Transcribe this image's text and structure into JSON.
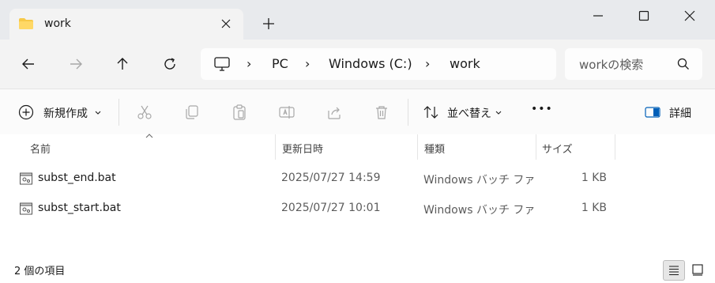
{
  "tab": {
    "title": "work",
    "folder_icon": "folder-icon",
    "close_icon": "close-icon"
  },
  "window_controls": {
    "minimize": "minimize-icon",
    "maximize": "maximize-icon",
    "close": "close-icon"
  },
  "nav": {
    "back": "back-arrow-icon",
    "forward": "forward-arrow-icon",
    "up": "up-arrow-icon",
    "refresh": "refresh-icon"
  },
  "address": {
    "root_icon": "computer-icon",
    "separator": "›",
    "breadcrumbs": [
      "PC",
      "Windows (C:)",
      "work"
    ]
  },
  "search": {
    "placeholder": "workの検索"
  },
  "toolbar": {
    "new_label": "新規作成",
    "sort_label": "並べ替え",
    "more_label": "•••",
    "details_label": "詳細"
  },
  "columns": {
    "name": "名前",
    "date": "更新日時",
    "type": "種類",
    "size": "サイズ"
  },
  "files": [
    {
      "name": "subst_end.bat",
      "date": "2025/07/27 14:59",
      "type": "Windows バッチ ファイル",
      "size": "1 KB"
    },
    {
      "name": "subst_start.bat",
      "date": "2025/07/27 10:01",
      "type": "Windows バッチ ファイル",
      "size": "1 KB"
    }
  ],
  "status": {
    "item_count": "2 個の項目"
  },
  "colors": {
    "tab_strip": "#e8eaed",
    "nav_bar": "#f3f3f3",
    "folder": "#f7c948",
    "accent": "#005fb8"
  }
}
